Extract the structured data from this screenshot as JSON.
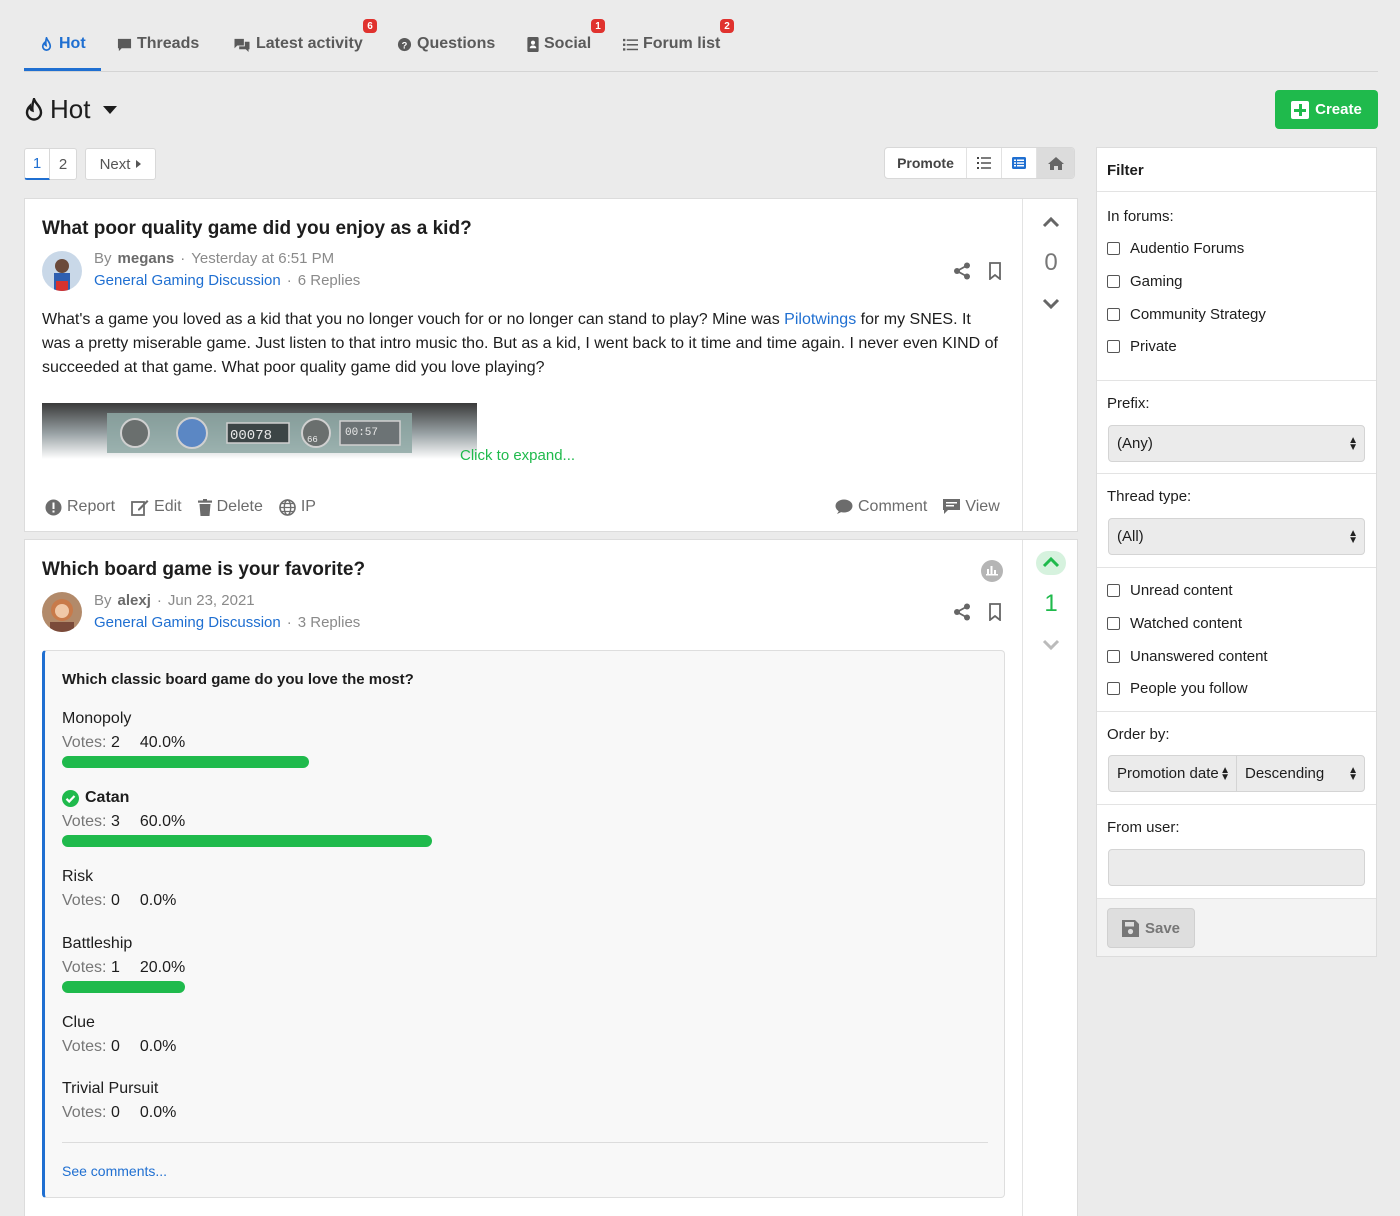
{
  "tabs": [
    {
      "label": "Hot",
      "icon": "flame-icon",
      "active": true
    },
    {
      "label": "Threads",
      "icon": "comment-icon"
    },
    {
      "label": "Latest activity",
      "icon": "comments-icon",
      "badge": "6"
    },
    {
      "label": "Questions",
      "icon": "question-circle-icon"
    },
    {
      "label": "Social",
      "icon": "address-book-icon",
      "badge": "1"
    },
    {
      "label": "Forum list",
      "icon": "list-icon",
      "badge": "2"
    }
  ],
  "page": {
    "title": "Hot",
    "create_label": "Create"
  },
  "pager": {
    "pages": [
      "1",
      "2"
    ],
    "next_label": "Next"
  },
  "view_tools": {
    "promote_label": "Promote"
  },
  "threads": [
    {
      "title": "What poor quality game did you enjoy as a kid?",
      "by_label": "By",
      "author": "megans",
      "date": "Yesterday at 6:51 PM",
      "forum": "General Gaming Discussion",
      "replies": "6 Replies",
      "votes": "0",
      "body_before": "What's a game you loved as a kid that you no longer vouch for or no longer can stand to play? Mine was ",
      "body_link": "Pilotwings",
      "body_after": " for my SNES. It was a pretty miserable game. Just listen to that intro music tho. But as a kid, I went back to it time and time again. I never even KIND of succeeded at that game. What poor quality game did you love playing?",
      "image_readout_1": "00078",
      "image_readout_2": "00:57",
      "image_readout_3": "66",
      "expand_label": "Click to expand...",
      "actions": [
        "Report",
        "Edit",
        "Delete",
        "IP"
      ],
      "right_actions": [
        "Comment",
        "View"
      ]
    },
    {
      "title": "Which board game is your favorite?",
      "by_label": "By",
      "author": "alexj",
      "date": "Jun 23, 2021",
      "forum": "General Gaming Discussion",
      "replies": "3 Replies",
      "votes": "1",
      "poll": {
        "question": "Which classic board game do you love the most?",
        "votes_label": "Votes:",
        "options": [
          {
            "name": "Monopoly",
            "votes": "2",
            "pct": "40.0%",
            "fraction": 0.4
          },
          {
            "name": "Catan",
            "votes": "3",
            "pct": "60.0%",
            "fraction": 0.6,
            "winner": true
          },
          {
            "name": "Risk",
            "votes": "0",
            "pct": "0.0%",
            "fraction": 0.0
          },
          {
            "name": "Battleship",
            "votes": "1",
            "pct": "20.0%",
            "fraction": 0.2
          },
          {
            "name": "Clue",
            "votes": "0",
            "pct": "0.0%",
            "fraction": 0.0
          },
          {
            "name": "Trivial Pursuit",
            "votes": "0",
            "pct": "0.0%",
            "fraction": 0.0
          }
        ],
        "see_comments": "See comments..."
      }
    }
  ],
  "filter": {
    "title": "Filter",
    "in_forums_label": "In forums:",
    "forums": [
      "Audentio Forums",
      "Gaming",
      "Community Strategy",
      "Private"
    ],
    "prefix_label": "Prefix:",
    "prefix_value": "(Any)",
    "thread_type_label": "Thread type:",
    "thread_type_value": "(All)",
    "content_filters": [
      "Unread content",
      "Watched content",
      "Unanswered content",
      "People you follow"
    ],
    "order_by_label": "Order by:",
    "order_field": "Promotion date",
    "order_dir": "Descending",
    "from_user_label": "From user:",
    "save_label": "Save"
  },
  "colors": {
    "accent": "#1f6fd1",
    "success": "#1fba4c",
    "badge": "#e0322e"
  }
}
